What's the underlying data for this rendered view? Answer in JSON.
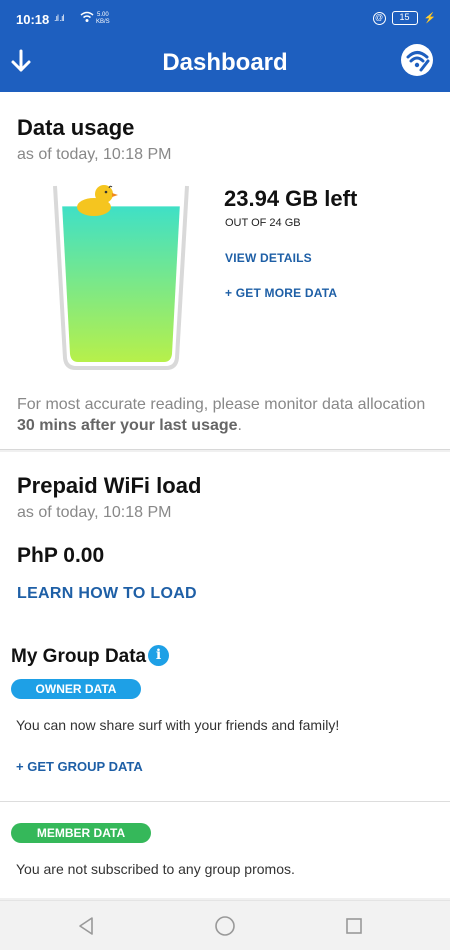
{
  "status_bar": {
    "time": "10:18",
    "signal": ".ıl .ıl",
    "speed_value": "5.00",
    "speed_unit": "KB/S",
    "battery_level": "15"
  },
  "app_bar": {
    "title": "Dashboard",
    "left_icon": "download-arrow-icon",
    "right_icon": "wifi-logo-icon",
    "color": "#1e5fbf"
  },
  "data_usage": {
    "title": "Data usage",
    "as_of": "as of today, 10:18 PM",
    "remaining": "23.94 GB left",
    "total": "OUT OF 24 GB",
    "fill_fraction": 0.9975,
    "view_details": "VIEW DETAILS",
    "get_more": "+ GET MORE DATA",
    "note_prefix": "For most accurate reading, please monitor data allocation ",
    "note_bold": "30 mins after your last usage",
    "note_suffix": "."
  },
  "wifi_load": {
    "title": "Prepaid WiFi load",
    "as_of": "as of today, 10:18 PM",
    "balance": "PhP 0.00",
    "learn_link": "LEARN HOW TO LOAD"
  },
  "group_data": {
    "title": "My Group Data",
    "info_glyph": "i",
    "owner_badge": "OWNER DATA",
    "owner_text": "You can now share surf with your friends and family!",
    "get_group": "+ GET GROUP DATA",
    "member_badge": "MEMBER DATA",
    "member_text": "You are not subscribed to any group promos."
  },
  "nav": {
    "icons": [
      "back-triangle-icon",
      "home-circle-icon",
      "recents-square-icon"
    ]
  }
}
